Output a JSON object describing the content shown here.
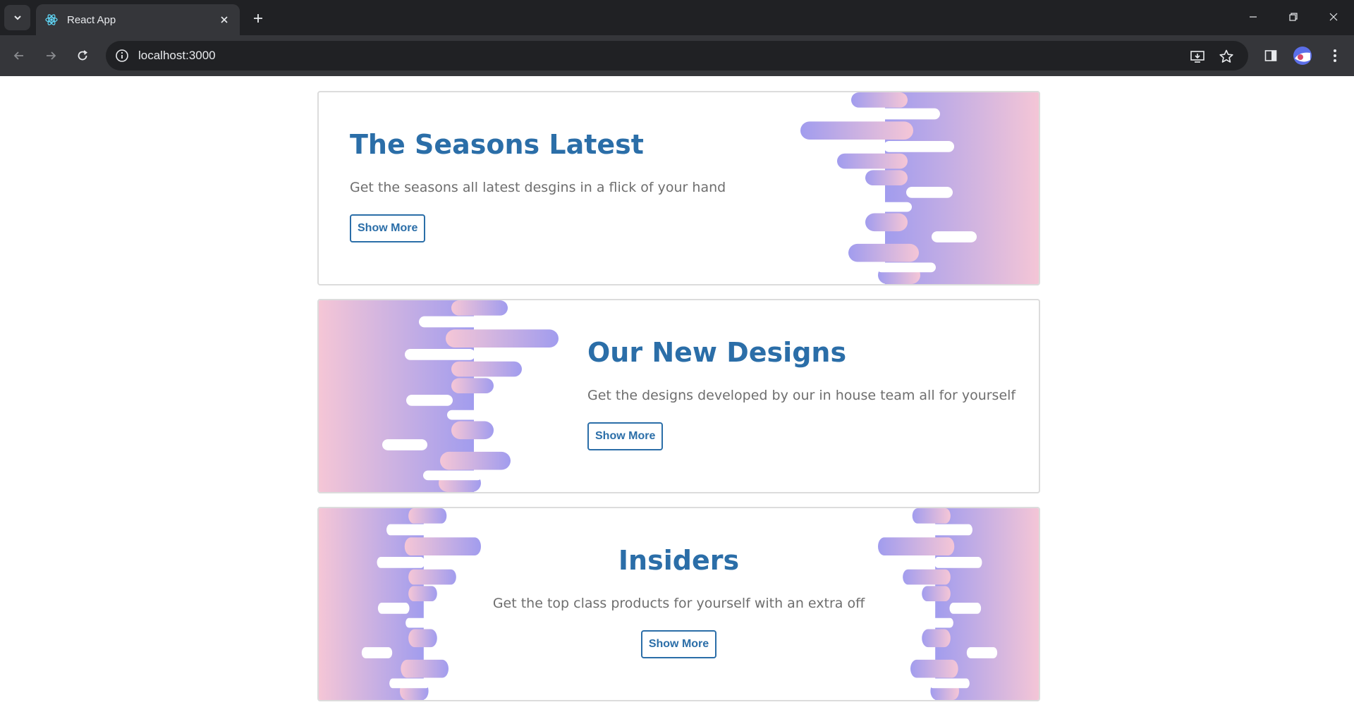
{
  "browser": {
    "tab_title": "React App",
    "url": "localhost:3000",
    "icons": [
      "tab-search-icon",
      "react-favicon-icon",
      "close-icon",
      "plus-icon",
      "minimize-icon",
      "restore-icon",
      "close-window-icon",
      "back-icon",
      "forward-icon",
      "reload-icon",
      "info-icon",
      "install-icon",
      "star-icon",
      "sidepanel-icon",
      "avatar-icon",
      "menu-icon"
    ]
  },
  "cards": [
    {
      "title": "The Seasons Latest",
      "description": "Get the seasons all latest desgins in a flick of your hand",
      "button": "Show More"
    },
    {
      "title": "Our New Designs",
      "description": "Get the designs developed by our in house team all for yourself",
      "button": "Show More"
    },
    {
      "title": "Insiders",
      "description": "Get the top class products for yourself with an extra off",
      "button": "Show More"
    }
  ],
  "colors": {
    "accent": "#2b6ea8",
    "gradient_purple": "#a19cee",
    "gradient_pink": "#f5c6d6"
  }
}
